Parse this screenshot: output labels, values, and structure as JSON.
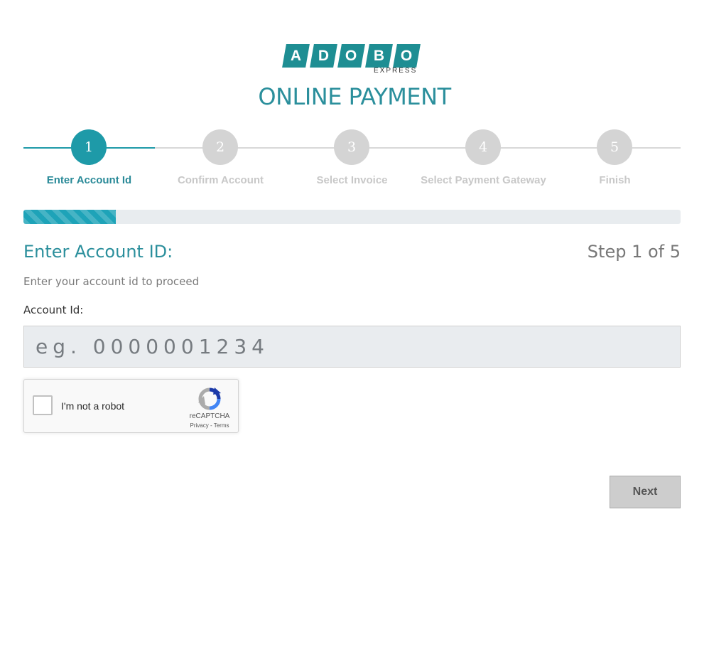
{
  "logo": {
    "letters": [
      "A",
      "D",
      "O",
      "B",
      "O"
    ],
    "subtitle": "EXPRESS",
    "color": "#1e8e93"
  },
  "header": {
    "title": "ONLINE PAYMENT"
  },
  "stepper": {
    "steps": [
      {
        "number": "1",
        "label": "Enter Account Id",
        "state": "active"
      },
      {
        "number": "2",
        "label": "Confirm Account",
        "state": "inactive"
      },
      {
        "number": "3",
        "label": "Select Invoice",
        "state": "inactive"
      },
      {
        "number": "4",
        "label": "Select Payment Gateway",
        "state": "inactive"
      },
      {
        "number": "5",
        "label": "Finish",
        "state": "inactive"
      }
    ],
    "active_color": "#1e9aa8",
    "inactive_color": "#d4d4d4"
  },
  "progress": {
    "fraction": 0.14,
    "color": "#1ea3b8"
  },
  "form": {
    "section_title": "Enter Account ID:",
    "step_counter": "Step 1 of 5",
    "instruction": "Enter your account id to proceed",
    "field_label": "Account Id:",
    "field_value": "",
    "field_placeholder": "eg. 0000001234"
  },
  "recaptcha": {
    "label": "I'm not a robot",
    "brand": "reCAPTCHA",
    "privacy": "Privacy",
    "separator": " - ",
    "terms": "Terms",
    "checked": false
  },
  "actions": {
    "next_label": "Next"
  }
}
